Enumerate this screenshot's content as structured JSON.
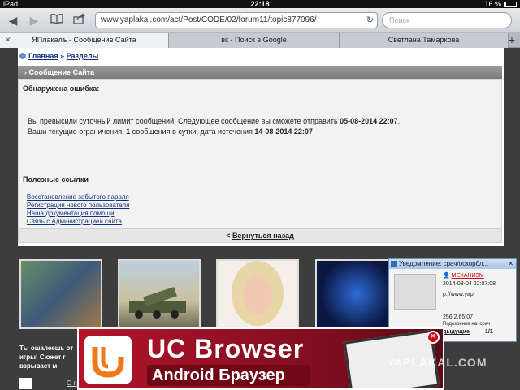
{
  "status": {
    "device": "iPad",
    "time": "22:18",
    "battery": "16 %"
  },
  "toolbar": {
    "url": "www.yaplakal.com/act/Post/CODE/02/forum11/topic877096/",
    "search_placeholder": "Поиск"
  },
  "tabs": [
    {
      "label": "ЯПлакалъ - Сообщение Сайта",
      "active": true
    },
    {
      "label": "вк - Поиск в Google",
      "active": false
    },
    {
      "label": "Светлана Тамаркова",
      "active": false
    }
  ],
  "breadcrumb": {
    "home": "Главная",
    "sep": "»",
    "section": "Разделы"
  },
  "panel": {
    "header": "Сообщение Сайта",
    "error_title": "Обнаружена ошибка:",
    "msg1_text": "Вы превысили суточный лимит сообщений. Следующее сообщение вы сможете отправить ",
    "msg1_date": "05-08-2014 22:07",
    "msg1_end": ".",
    "msg2_text": "Ваши текущие ограничения: ",
    "msg2_count": "1",
    "msg2_mid": " сообщения в сутки, дата истечения ",
    "msg2_date": "14-08-2014 22:07",
    "links_title": "Полезные ссылки",
    "links": [
      "Восстановление забытого пароля",
      "Регистрация нового пользователя",
      "Наша документация помощи",
      "Связь с Администрацией сайта"
    ],
    "back": "Вернуться назад"
  },
  "thumb_caption": "Ты ошалеешь от игры! Сюжет г взрывает м",
  "footer_text": "О пр",
  "notification": {
    "title": "Уведомление: срач/оскорбл...",
    "author": "МЕХАНИЗМ",
    "date": "2014-08-04 22:07:08",
    "url": "p://www.yap",
    "ip": "256.2.65.07",
    "reason": "Подозрение на: срач",
    "nav": "дыдущие",
    "page": "1/1"
  },
  "ad": {
    "title": "UC Browser",
    "subtitle": "Android Браузер №1"
  },
  "watermark": "YAPLAKAL.COM",
  "colors": {
    "link": "#15327e",
    "ad_bg": "#b3142a",
    "notif_border": "#6f8fb5"
  }
}
